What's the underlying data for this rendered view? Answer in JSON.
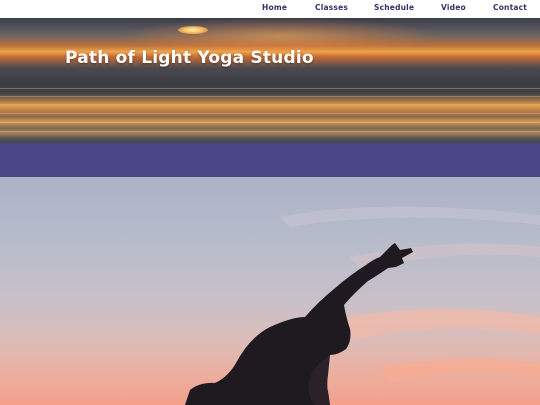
{
  "nav": {
    "items": [
      {
        "label": "Home"
      },
      {
        "label": "Classes"
      },
      {
        "label": "Schedule"
      },
      {
        "label": "Video"
      },
      {
        "label": "Contact"
      }
    ]
  },
  "header": {
    "title": "Path of Light Yoga Studio"
  },
  "colors": {
    "nav_text": "#3b2f6b",
    "band": "#4a4585",
    "title_text": "#ffffff"
  },
  "hero": {
    "image": "yoga-silhouette-sunset"
  }
}
